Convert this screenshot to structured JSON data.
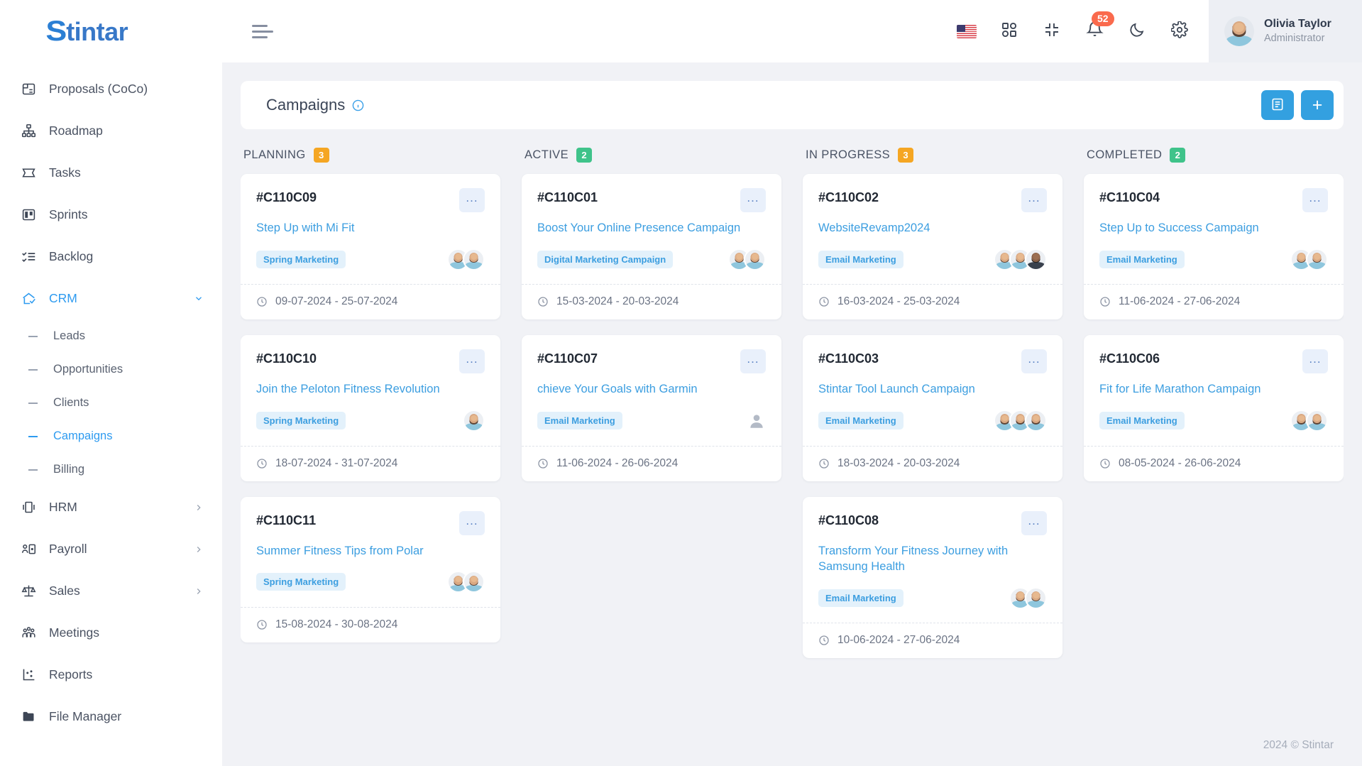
{
  "brand": {
    "logo_first": "S",
    "logo_rest": "tintar"
  },
  "sidebar": {
    "items": [
      {
        "label": "Proposals (CoCo)",
        "icon": "proposals-icon"
      },
      {
        "label": "Roadmap",
        "icon": "roadmap-icon"
      },
      {
        "label": "Tasks",
        "icon": "tasks-icon"
      },
      {
        "label": "Sprints",
        "icon": "sprints-icon"
      },
      {
        "label": "Backlog",
        "icon": "backlog-icon"
      },
      {
        "label": "CRM",
        "icon": "crm-icon"
      },
      {
        "label": "HRM",
        "icon": "hrm-icon"
      },
      {
        "label": "Payroll",
        "icon": "payroll-icon"
      },
      {
        "label": "Sales",
        "icon": "sales-icon"
      },
      {
        "label": "Meetings",
        "icon": "meetings-icon"
      },
      {
        "label": "Reports",
        "icon": "reports-icon"
      },
      {
        "label": "File Manager",
        "icon": "folder-icon"
      }
    ],
    "crm_children": [
      {
        "label": "Leads"
      },
      {
        "label": "Opportunities"
      },
      {
        "label": "Clients"
      },
      {
        "label": "Campaigns"
      },
      {
        "label": "Billing"
      }
    ],
    "active_item": "CRM",
    "active_child": "Campaigns",
    "accent_color": "#2e9bf0"
  },
  "topbar": {
    "menu_icon": "hamburger-icon",
    "language_flag": "us-flag-icon",
    "apps_icon": "grid-apps-icon",
    "fullscreen_icon": "fullscreen-exit-icon",
    "notifications_icon": "bell-icon",
    "notifications_count": "52",
    "dark_mode_icon": "moon-icon",
    "settings_icon": "gear-icon",
    "user_name": "Olivia Taylor",
    "user_role": "Administrator",
    "badge_color": "#fa6a4d"
  },
  "page": {
    "title": "Campaigns",
    "info_icon": "info-icon",
    "list_view_button": "list-view-icon",
    "add_button_label": "+"
  },
  "board": {
    "columns": [
      {
        "title": "PLANNING",
        "count": "3",
        "count_color": "#f5a623",
        "cards": [
          {
            "id": "#C110C09",
            "title": "Step Up with Mi Fit",
            "tag": "Spring Marketing",
            "dates": "09-07-2024 - 25-07-2024",
            "avatars": [
              "light",
              "light"
            ]
          },
          {
            "id": "#C110C10",
            "title": "Join the Peloton Fitness Revolution",
            "tag": "Spring Marketing",
            "dates": "18-07-2024 - 31-07-2024",
            "avatars": [
              "light"
            ]
          },
          {
            "id": "#C110C11",
            "title": "Summer Fitness Tips from Polar",
            "tag": "Spring Marketing",
            "dates": "15-08-2024 - 30-08-2024",
            "avatars": [
              "light",
              "light"
            ]
          }
        ]
      },
      {
        "title": "ACTIVE",
        "count": "2",
        "count_color": "#3fc38a",
        "cards": [
          {
            "id": "#C110C01",
            "title": "Boost Your Online Presence Campaign",
            "tag": "Digital Marketing Campaign",
            "dates": "15-03-2024 - 20-03-2024",
            "avatars": [
              "light",
              "light"
            ]
          },
          {
            "id": "#C110C07",
            "title": "chieve Your Goals with Garmin",
            "tag": "Email Marketing",
            "dates": "11-06-2024 - 26-06-2024",
            "avatars": [
              "placeholder"
            ]
          }
        ]
      },
      {
        "title": "IN PROGRESS",
        "count": "3",
        "count_color": "#f5a623",
        "cards": [
          {
            "id": "#C110C02",
            "title": "WebsiteRevamp2024",
            "tag": "Email Marketing",
            "dates": "16-03-2024 - 25-03-2024",
            "avatars": [
              "light",
              "light",
              "dark"
            ]
          },
          {
            "id": "#C110C03",
            "title": "Stintar Tool Launch Campaign",
            "tag": "Email Marketing",
            "dates": "18-03-2024 - 20-03-2024",
            "avatars": [
              "light",
              "light",
              "light"
            ]
          },
          {
            "id": "#C110C08",
            "title": "Transform Your Fitness Journey with Samsung Health",
            "tag": "Email Marketing",
            "dates": "10-06-2024 - 27-06-2024",
            "avatars": [
              "light",
              "light"
            ]
          }
        ]
      },
      {
        "title": "COMPLETED",
        "count": "2",
        "count_color": "#3fc38a",
        "cards": [
          {
            "id": "#C110C04",
            "title": "Step Up to Success Campaign",
            "tag": "Email Marketing",
            "dates": "11-06-2024 - 27-06-2024",
            "avatars": [
              "light",
              "light"
            ]
          },
          {
            "id": "#C110C06",
            "title": "Fit for Life Marathon Campaign",
            "tag": "Email Marketing",
            "dates": "08-05-2024 - 26-06-2024",
            "avatars": [
              "light",
              "light"
            ]
          }
        ]
      }
    ],
    "card_menu_label": "...",
    "clock_icon": "clock-icon"
  },
  "footer": {
    "text": "2024 © Stintar"
  }
}
